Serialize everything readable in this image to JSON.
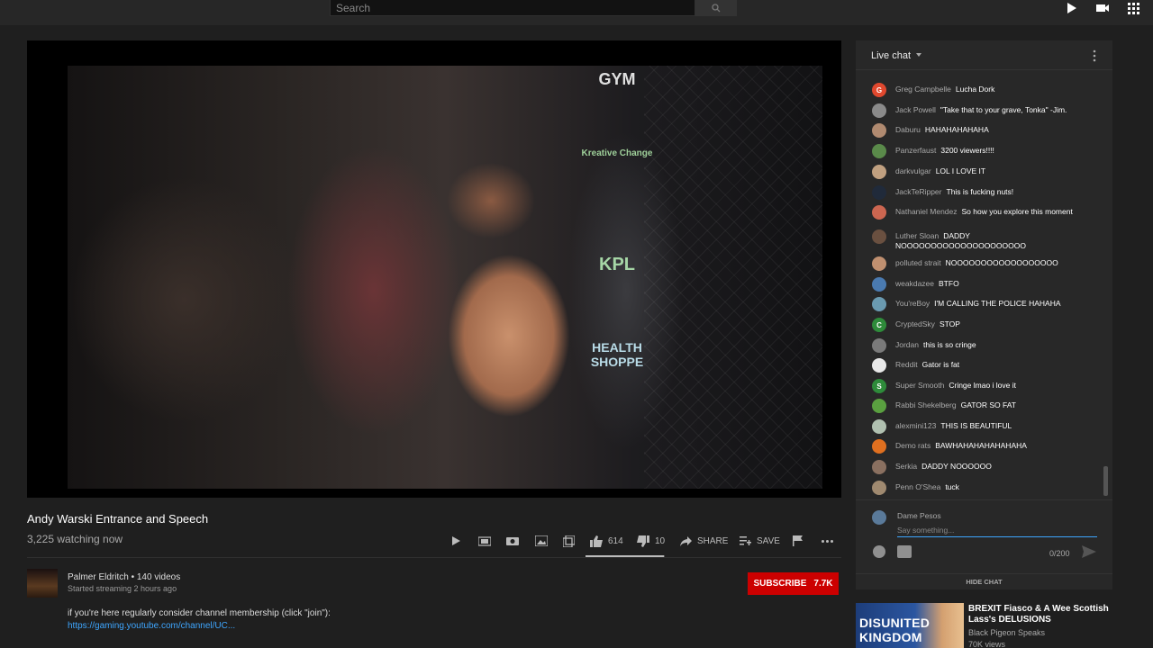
{
  "header": {
    "search_placeholder": "Search"
  },
  "video": {
    "sponsors": [
      "GYM",
      "Kreative Change",
      "KPL",
      "HEALTH SHOPPE"
    ],
    "title": "Andy Warski Entrance and Speech",
    "viewers": "3,225 watching now",
    "likes": "614",
    "dislikes": "10",
    "like_ratio": 0.984,
    "share_label": "SHARE",
    "save_label": "SAVE"
  },
  "channel": {
    "name_line": "Palmer Eldritch • 140 videos",
    "started": "Started streaming 2 hours ago",
    "subscribe_label": "SUBSCRIBE",
    "subscriber_count": "7.7K",
    "description": "if you're here regularly consider channel membership (click \"join\"):",
    "link": "https://gaming.youtube.com/channel/UC..."
  },
  "chat": {
    "header": "Live chat",
    "messages": [
      {
        "author": "Greg Campbelle",
        "text": "Lucha Dork",
        "initial": "G",
        "color": "#e0482e"
      },
      {
        "author": "Jack Powell",
        "text": "\"Take that to your grave, Tonka\" -Jim.",
        "initial": "",
        "color": "#8a8a8a"
      },
      {
        "author": "Daburu",
        "text": "HAHAHAHAHAHA",
        "initial": "",
        "color": "#b08a70"
      },
      {
        "author": "Panzerfaust",
        "text": "3200 viewers!!!!",
        "initial": "",
        "color": "#5a8a4a"
      },
      {
        "author": "darkvulgar",
        "text": "LOL I LOVE IT",
        "initial": "",
        "color": "#c0a080"
      },
      {
        "author": "JackTeRipper",
        "text": "This is fucking nuts!",
        "initial": "",
        "color": "#202a3a"
      },
      {
        "author": "Nathaniel Mendez",
        "text": "So how you explore this moment",
        "initial": "",
        "color": "#cc6650"
      },
      {
        "author": "Luther Sloan",
        "text": "DADDY NOOOOOOOOOOOOOOOOOOOOO",
        "initial": "",
        "color": "#6a5040"
      },
      {
        "author": "polluted strait",
        "text": "NOOOOOOOOOOOOOOOOOO",
        "initial": "",
        "color": "#c09070"
      },
      {
        "author": "weakdazee",
        "text": "BTFO",
        "initial": "",
        "color": "#4a7ab0"
      },
      {
        "author": "You'reBoy",
        "text": "I'M CALLING THE POLICE HAHAHA",
        "initial": "",
        "color": "#6a9ab0"
      },
      {
        "author": "CryptedSky",
        "text": "STOP",
        "initial": "C",
        "color": "#2e8b3a"
      },
      {
        "author": "Jordan",
        "text": "this is so cringe",
        "initial": "",
        "color": "#7a7a7a"
      },
      {
        "author": "Reddit",
        "text": "Gator is fat",
        "initial": "",
        "color": "#e8e8e8"
      },
      {
        "author": "Super Smooth",
        "text": "Cringe lmao i love it",
        "initial": "S",
        "color": "#2e8b3a"
      },
      {
        "author": "Rabbi Shekelberg",
        "text": "GATOR SO FAT",
        "initial": "",
        "color": "#5aa040"
      },
      {
        "author": "alexmini123",
        "text": "THIS IS BEAUTIFUL",
        "initial": "",
        "color": "#b0c0b0"
      },
      {
        "author": "Demo rats",
        "text": "BAWHAHAHAHAHAHAHA",
        "initial": "",
        "color": "#e07020"
      },
      {
        "author": "Serkia",
        "text": "DADDY NOOOOOO",
        "initial": "",
        "color": "#8a7060"
      },
      {
        "author": "Penn O'Shea",
        "text": "tuck",
        "initial": "",
        "color": "#a08a70"
      }
    ],
    "input_author": "Dame Pesos",
    "input_placeholder": "Say something...",
    "char_count": "0/200",
    "hide_label": "HIDE CHAT"
  },
  "recommendation": {
    "thumb_text": "DISUNITED KINGDOM",
    "title": "BREXIT Fiasco & A Wee Scottish Lass's DELUSIONS",
    "channel": "Black Pigeon Speaks",
    "views": "70K views"
  },
  "colors": {
    "accent": "#cc0000",
    "link": "#3ea6ff",
    "background": "#1f1f1f"
  }
}
